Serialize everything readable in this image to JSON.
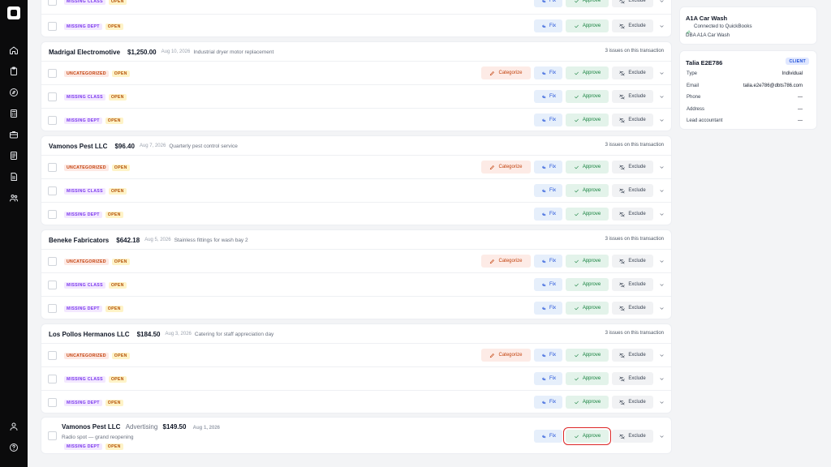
{
  "actions": {
    "categorize": "Categorize",
    "fix": "Fix",
    "approve": "Approve",
    "exclude": "Exclude"
  },
  "badges": {
    "missing_class": "MISSING CLASS",
    "missing_dept": "MISSING DEPT",
    "uncategorized": "UNCATEGORIZED",
    "open": "OPEN"
  },
  "transactions": [
    {
      "vendor": "Madrigal Electromotive",
      "amount": "$1,250.00",
      "date": "Aug 10, 2026",
      "description": "Industrial dryer motor replacement",
      "issues": "3 issues on this transaction"
    },
    {
      "vendor": "Vamonos Pest LLC",
      "amount": "$96.40",
      "date": "Aug 7, 2026",
      "description": "Quarterly pest control service",
      "issues": "3 issues on this transaction"
    },
    {
      "vendor": "Beneke Fabricators",
      "amount": "$642.18",
      "date": "Aug 5, 2026",
      "description": "Stainless fittings for wash bay 2",
      "issues": "3 issues on this transaction"
    },
    {
      "vendor": "Los Pollos Hermanos LLC",
      "amount": "$184.50",
      "date": "Aug 3, 2026",
      "description": "Catering for staff appreciation day",
      "issues": "3 issues on this transaction"
    }
  ],
  "last_transaction": {
    "vendor": "Vamonos Pest LLC",
    "category": "Advertising",
    "amount": "$149.50",
    "date": "Aug 1, 2026",
    "memo": "Radio spot — grand reopening"
  },
  "company": {
    "name": "A1A Car Wash",
    "connection": "Connected to QuickBooks",
    "dba": "DBA A1A Car Wash"
  },
  "client": {
    "name": "Talia E2E786",
    "badge": "CLIENT",
    "fields": [
      {
        "label": "Type",
        "value": "Individual"
      },
      {
        "label": "Email",
        "value": "talia.e2e786@dbts786.com"
      },
      {
        "label": "Phone",
        "value": "—"
      },
      {
        "label": "Address",
        "value": "—"
      },
      {
        "label": "Lead accountant",
        "value": "—"
      }
    ]
  },
  "icons": {
    "nav": [
      "home-icon",
      "clipboard-icon",
      "compass-icon",
      "calculator-icon",
      "briefcase-icon",
      "document-icon",
      "report-icon",
      "users-icon"
    ],
    "bottom": [
      "user-icon",
      "help-icon"
    ]
  }
}
